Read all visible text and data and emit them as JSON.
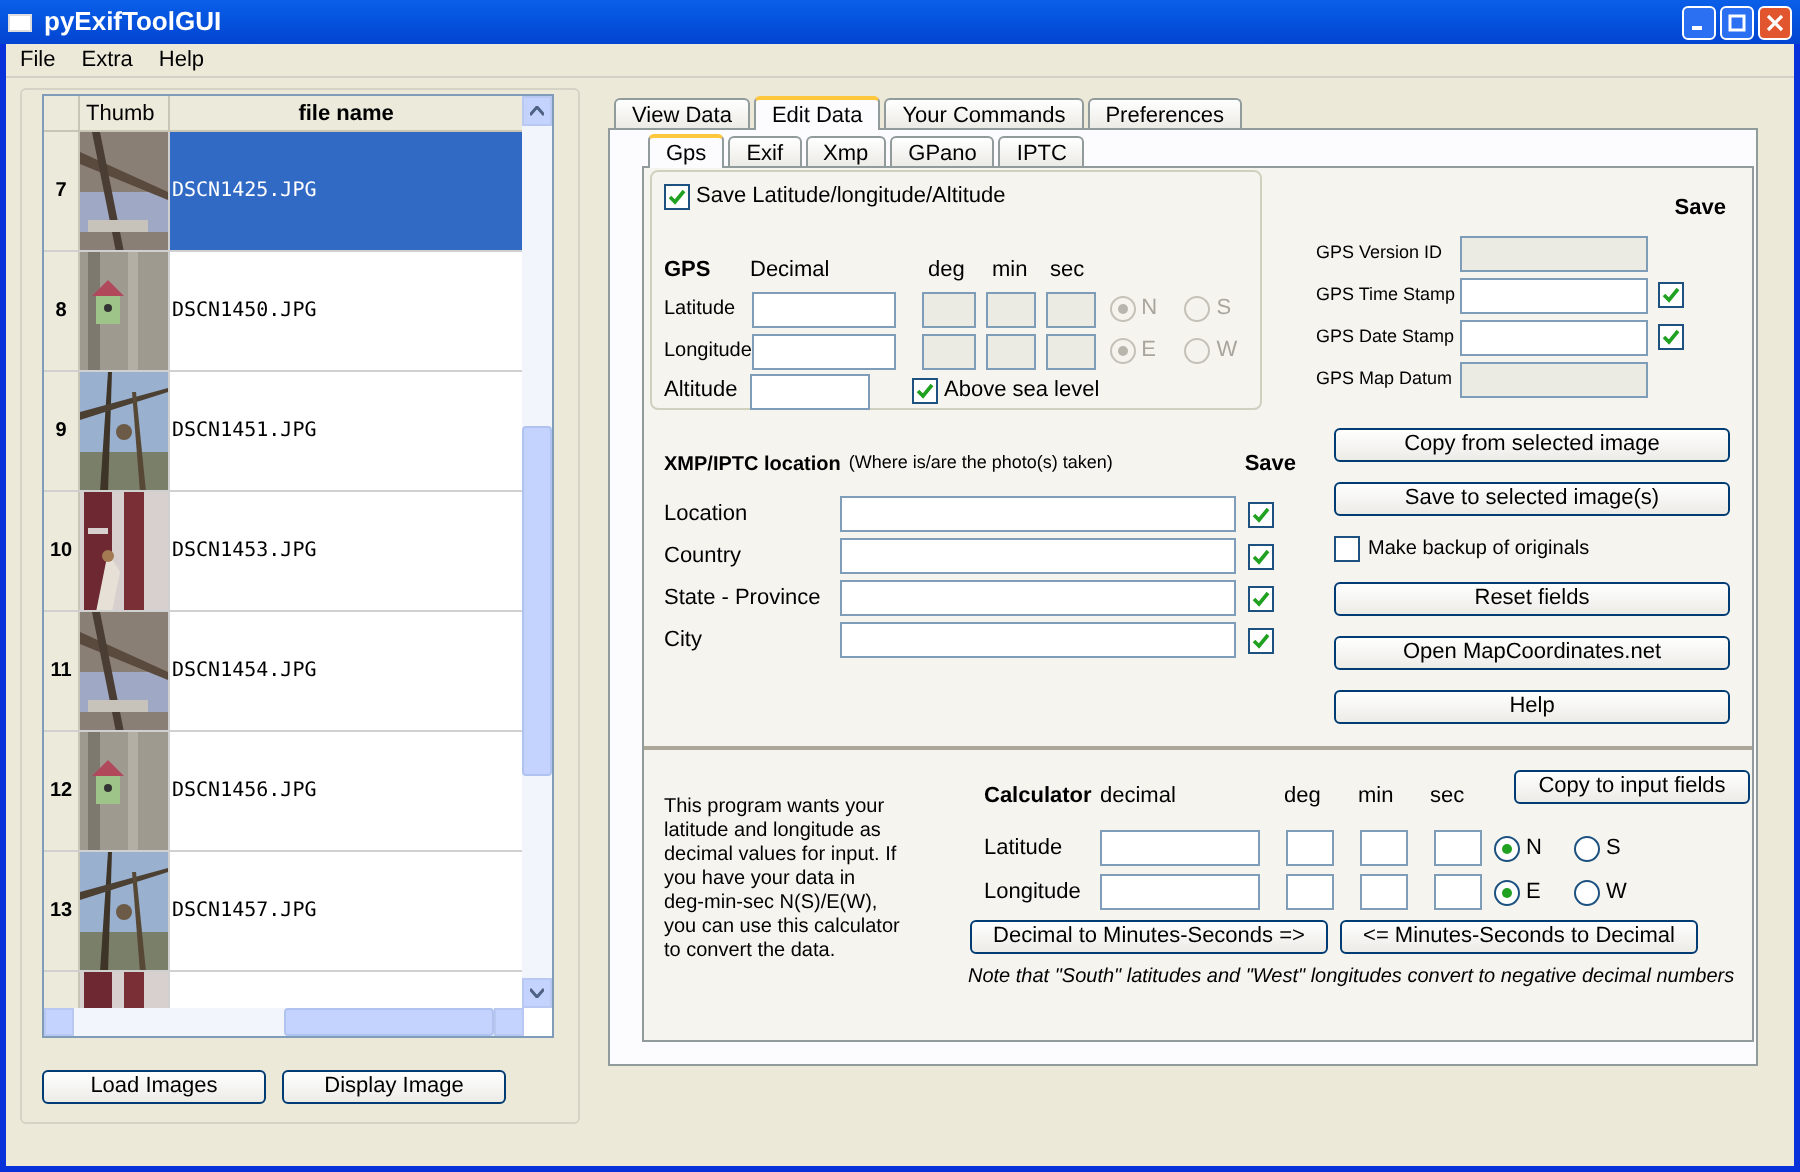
{
  "window": {
    "title": "pyExifToolGUI"
  },
  "menu": [
    "File",
    "Extra",
    "Help"
  ],
  "table": {
    "columns": [
      "Thumb",
      "file name"
    ],
    "rows": [
      {
        "number": "7",
        "file": "DSCN1425.JPG",
        "selected": true
      },
      {
        "number": "8",
        "file": "DSCN1450.JPG",
        "selected": false
      },
      {
        "number": "9",
        "file": "DSCN1451.JPG",
        "selected": false
      },
      {
        "number": "10",
        "file": "DSCN1453.JPG",
        "selected": false
      },
      {
        "number": "11",
        "file": "DSCN1454.JPG",
        "selected": false
      },
      {
        "number": "12",
        "file": "DSCN1456.JPG",
        "selected": false
      },
      {
        "number": "13",
        "file": "DSCN1457.JPG",
        "selected": false
      },
      {
        "selected": false
      }
    ]
  },
  "left_buttons": [
    "Load Images",
    "Display Image"
  ],
  "tabs": [
    {
      "label": "View Data",
      "selected": false
    },
    {
      "label": "Edit Data",
      "selected": true
    },
    {
      "label": "Your Commands",
      "selected": false
    },
    {
      "label": "Preferences",
      "selected": false
    }
  ],
  "subtabs": [
    {
      "label": "Gps",
      "selected": true
    },
    {
      "label": "Exif",
      "selected": false
    },
    {
      "label": "Xmp",
      "selected": false
    },
    {
      "label": "GPano",
      "selected": false
    },
    {
      "label": "IPTC",
      "selected": false
    }
  ],
  "gps": {
    "save_option": {
      "label": "Save Latitude/longitude/Altitude",
      "checked": true
    },
    "headers": [
      "GPS",
      "Decimal",
      "deg",
      "min",
      "sec"
    ],
    "rows": [
      {
        "label": "Latitude",
        "radios": [
          {
            "label": "N",
            "selected": true
          },
          {
            "label": "S",
            "selected": false
          }
        ]
      },
      {
        "label": "Longitude",
        "radios": [
          {
            "label": "E",
            "selected": true
          },
          {
            "label": "W",
            "selected": false
          }
        ]
      }
    ],
    "altitude": {
      "label": "Altitude",
      "option": {
        "label": "Above sea level",
        "checked": true
      }
    }
  },
  "gps_tags": {
    "save_heading": "Save",
    "fields": [
      {
        "label": "GPS Version ID",
        "disabled": true
      },
      {
        "label": "GPS Time Stamp",
        "disabled": false,
        "save": true
      },
      {
        "label": "GPS Date Stamp",
        "disabled": false,
        "save": true
      },
      {
        "label": "GPS Map Datum",
        "disabled": true
      }
    ]
  },
  "location": {
    "title": "XMP/IPTC location",
    "hint": "(Where is/are the photo(s) taken)",
    "save_heading": "Save",
    "fields": [
      {
        "label": "Location",
        "save": true
      },
      {
        "label": "Country",
        "save": true
      },
      {
        "label": "State - Province",
        "save": true
      },
      {
        "label": "City",
        "save": true
      }
    ]
  },
  "actions": [
    {
      "kind": "button",
      "label": "Copy from selected image"
    },
    {
      "kind": "button",
      "label": "Save to selected image(s)"
    },
    {
      "kind": "checkbox",
      "label": "Make backup of originals",
      "checked": false
    },
    {
      "kind": "button",
      "label": "Reset fields"
    },
    {
      "kind": "button",
      "label": "Open MapCoordinates.net"
    },
    {
      "kind": "button",
      "label": "Help"
    }
  ],
  "calculator": {
    "description": "This program wants your latitude and longitude as decimal values for input. If you have your data in deg-min-sec N(S)/E(W), you can use this calculator to convert the data.",
    "headers": [
      "Calculator",
      "decimal",
      "deg",
      "min",
      "sec"
    ],
    "copy_button": "Copy to input fields",
    "rows": [
      {
        "label": "Latitude",
        "radios": [
          {
            "label": "N",
            "selected": true
          },
          {
            "label": "S",
            "selected": false
          }
        ]
      },
      {
        "label": "Longitude",
        "radios": [
          {
            "label": "E",
            "selected": true
          },
          {
            "label": "W",
            "selected": false
          }
        ]
      }
    ],
    "buttons": [
      "Decimal to Minutes-Seconds =>",
      "<= Minutes-Seconds to Decimal"
    ],
    "note": "Note that \"South\" latitudes and \"West\" longitudes convert to negative decimal numbers"
  }
}
